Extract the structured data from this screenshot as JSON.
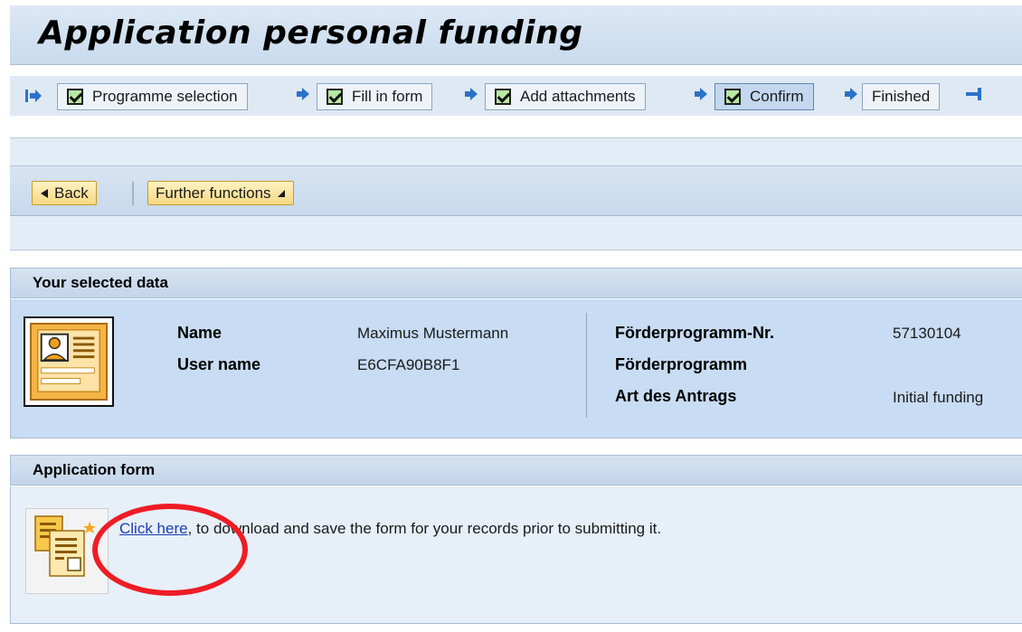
{
  "header": {
    "title": "Application personal funding"
  },
  "roadmap": {
    "steps": [
      {
        "label": "Programme selection",
        "checked": true,
        "active": false
      },
      {
        "label": "Fill in form",
        "checked": true,
        "active": false
      },
      {
        "label": "Add attachments",
        "checked": true,
        "active": false
      },
      {
        "label": "Confirm",
        "checked": true,
        "active": true
      },
      {
        "label": "Finished",
        "checked": false,
        "active": false
      }
    ]
  },
  "toolbar": {
    "back_label": "Back",
    "further_label": "Further functions"
  },
  "selected_data": {
    "heading": "Your selected data",
    "name_label": "Name",
    "name_value": "Maximus Mustermann",
    "username_label": "User name",
    "username_value": "E6CFA90B8F1",
    "programme_nr_label": "Förderprogramm-Nr.",
    "programme_nr_value": "57130104",
    "programme_label": "Förderprogramm",
    "art_label": "Art des Antrags",
    "art_value": "Initial funding"
  },
  "application_form": {
    "heading": "Application form",
    "link_text": "Click here",
    "rest_text": ", to download and save the form for your records prior to submitting it."
  },
  "colors": {
    "accent_blue": "#c8dcf3",
    "button_gold": "#f6d884",
    "highlight_red": "#ee1c25",
    "check_green": "#b7e7a2"
  }
}
